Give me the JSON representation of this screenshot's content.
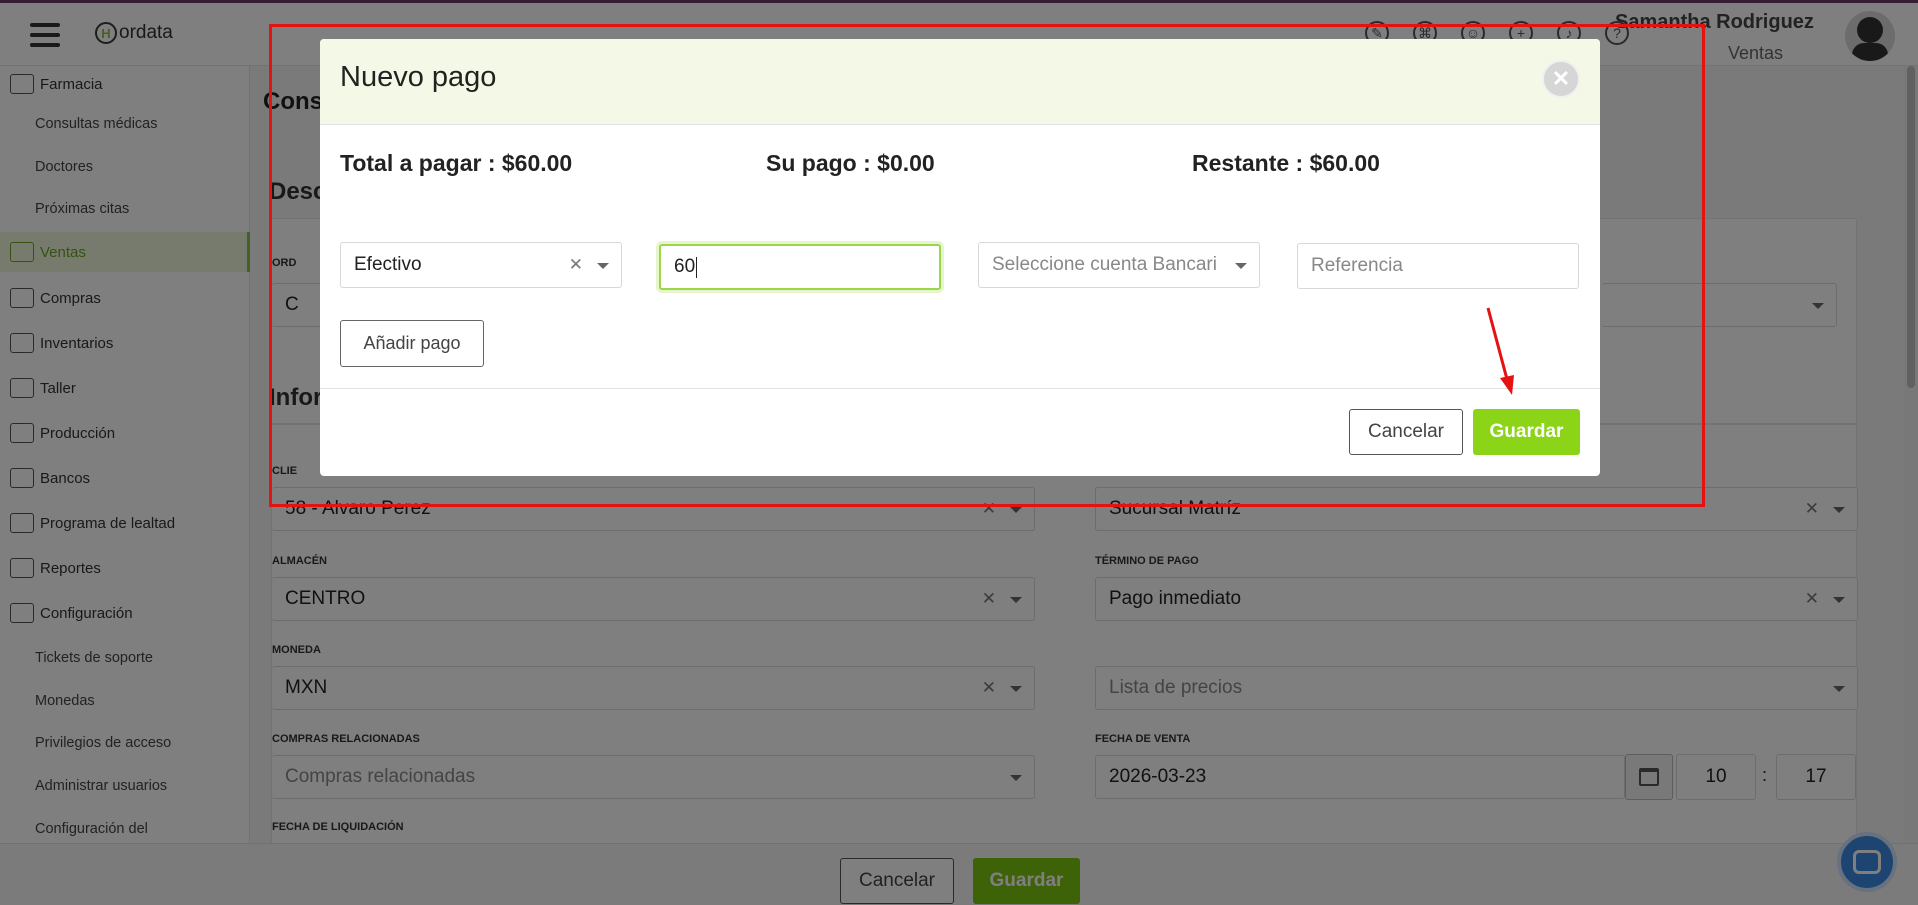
{
  "header": {
    "logo_letter": "H",
    "logo_text": "ordata",
    "user_name": "Samantha Rodriguez",
    "user_role": "Ventas",
    "icons": [
      "edit-icon",
      "network-icon",
      "support-icon",
      "add-circle-icon",
      "bell-icon",
      "help-icon"
    ]
  },
  "sidebar": {
    "items": [
      {
        "label": "Farmacia",
        "type": "main",
        "icon": "pharmacy-icon"
      },
      {
        "label": "Consultas médicas",
        "type": "sub"
      },
      {
        "label": "Doctores",
        "type": "sub"
      },
      {
        "label": "Próximas citas",
        "type": "sub"
      },
      {
        "label": "Ventas",
        "type": "main",
        "icon": "sales-icon",
        "active": true
      },
      {
        "label": "Compras",
        "type": "main",
        "icon": "cart-icon"
      },
      {
        "label": "Inventarios",
        "type": "main",
        "icon": "inventory-icon"
      },
      {
        "label": "Taller",
        "type": "main",
        "icon": "car-icon"
      },
      {
        "label": "Producción",
        "type": "main",
        "icon": "factory-icon"
      },
      {
        "label": "Bancos",
        "type": "main",
        "icon": "piggy-bank-icon"
      },
      {
        "label": "Programa de lealtad",
        "type": "main",
        "icon": "loyalty-icon"
      },
      {
        "label": "Reportes",
        "type": "main",
        "icon": "report-icon"
      },
      {
        "label": "Configuración",
        "type": "main",
        "icon": "gear-icon"
      },
      {
        "label": "Tickets de soporte",
        "type": "sub"
      },
      {
        "label": "Monedas",
        "type": "sub"
      },
      {
        "label": "Privilegios de acceso",
        "type": "sub"
      },
      {
        "label": "Administrar usuarios",
        "type": "sub"
      },
      {
        "label": "Configuración del",
        "type": "sub"
      }
    ]
  },
  "main": {
    "page_title": "Cons",
    "section_desc": "Desc",
    "section_info": "Infor",
    "order_label": "ORD",
    "order_value": "C",
    "cliente_label": "CLIE",
    "cliente_value": "58 - Alvaro Perez",
    "sucursal_value": "Sucursal Matríz",
    "almacen_label": "ALMACÉN",
    "almacen_value": "CENTRO",
    "termino_label": "TÉRMINO DE PAGO",
    "termino_value": "Pago inmediato",
    "moneda_label": "MONEDA",
    "moneda_value": "MXN",
    "lista_placeholder": "Lista de precios",
    "compras_label": "COMPRAS RELACIONADAS",
    "compras_placeholder": "Compras relacionadas",
    "fecha_venta_label": "FECHA DE VENTA",
    "fecha_venta_value": "2026-03-23",
    "hora": "10",
    "time_sep": ":",
    "minuto": "17",
    "fecha_liq_label": "FECHA DE LIQUIDACIÓN"
  },
  "footer": {
    "cancel_label": "Cancelar",
    "save_label": "Guardar"
  },
  "modal": {
    "title": "Nuevo pago",
    "close_glyph": "✕",
    "total_label": "Total a pagar : $60.00",
    "su_pago_label": "Su pago : $0.00",
    "restante_label": "Restante : $60.00",
    "payment_method": "Efectivo",
    "amount_value": "60",
    "bank_placeholder": "Seleccione cuenta Bancari",
    "reference_placeholder": "Referencia",
    "add_payment_label": "Añadir pago",
    "cancel_label": "Cancelar",
    "save_label": "Guardar"
  },
  "colors": {
    "accent_green": "#8cd417",
    "annotation_red": "#e51212",
    "brand_purple": "#6b3a66",
    "chat_blue": "#3d8be5"
  }
}
